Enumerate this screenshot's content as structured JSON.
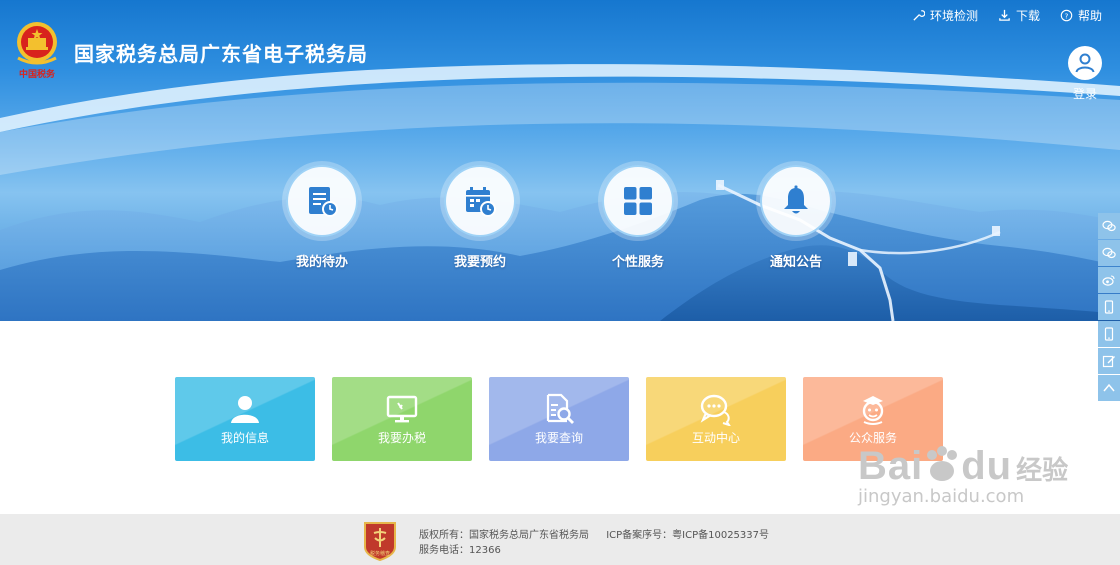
{
  "header": {
    "title": "国家税务总局广东省电子税务局",
    "logo_caption": "中国税务",
    "top_links": [
      {
        "label": "环境检测",
        "icon": "tool-icon"
      },
      {
        "label": "下载",
        "icon": "download-icon"
      },
      {
        "label": "帮助",
        "icon": "help-icon"
      }
    ],
    "login_label": "登录"
  },
  "hero_nav": [
    {
      "label": "我的待办",
      "icon": "todo-list-icon"
    },
    {
      "label": "我要预约",
      "icon": "calendar-icon"
    },
    {
      "label": "个性服务",
      "icon": "grid-icon"
    },
    {
      "label": "通知公告",
      "icon": "bell-icon"
    }
  ],
  "tiles": [
    {
      "label": "我的信息",
      "icon": "user-icon",
      "color": "#3cbde6"
    },
    {
      "label": "我要办税",
      "icon": "monitor-icon",
      "color": "#8fd66c"
    },
    {
      "label": "我要查询",
      "icon": "document-search-icon",
      "color": "#8ea8e8"
    },
    {
      "label": "互动中心",
      "icon": "chat-icon",
      "color": "#f7cf5c"
    },
    {
      "label": "公众服务",
      "icon": "service-person-icon",
      "color": "#fbaa84"
    }
  ],
  "sidebar": [
    "wechat-icon",
    "wechat-icon",
    "weibo-icon",
    "mobile-icon",
    "mobile-icon",
    "edit-icon",
    "back-to-top-icon"
  ],
  "footer": {
    "copyright": "版权所有：国家税务总局广东省税务局",
    "icp": "ICP备案序号：粤ICP备10025337号",
    "phone": "服务电话：12366",
    "emblem_caption": "税务稽查"
  },
  "watermark": {
    "brand": "Bai",
    "brand_end": "du",
    "brand_cn": "经验",
    "url": "jingyan.baidu.com"
  },
  "colors": {
    "hero_top": "#1677cf",
    "sidebar": "#8ec3ea",
    "footer_bg": "#ebebeb",
    "nav_icon": "#2f7fd0"
  }
}
